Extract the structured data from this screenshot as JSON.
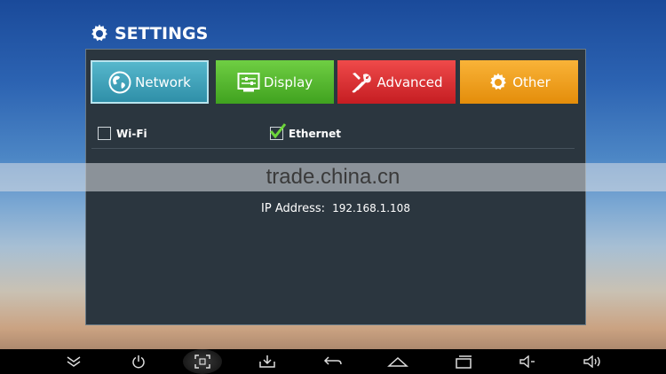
{
  "header": {
    "title": "SETTINGS",
    "icon": "gear-icon"
  },
  "tabs": [
    {
      "label": "Network",
      "icon": "globe-icon",
      "color": "#3aa0b9",
      "selected": true
    },
    {
      "label": "Display",
      "icon": "display-icon",
      "color": "#4fb82c"
    },
    {
      "label": "Advanced",
      "icon": "tools-icon",
      "color": "#d92c2f"
    },
    {
      "label": "Other",
      "icon": "gear-icon",
      "color": "#f0a020"
    }
  ],
  "options": [
    {
      "label": "Wi-Fi",
      "checked": false
    },
    {
      "label": "Ethernet",
      "checked": true
    }
  ],
  "network": {
    "ip_label": "IP Address:",
    "ip_value": "192.168.1.108"
  },
  "watermark": "trade.china.cn",
  "navbar": [
    {
      "icon": "collapse-chevron-icon"
    },
    {
      "icon": "power-icon"
    },
    {
      "icon": "screenshot-icon"
    },
    {
      "icon": "download-icon"
    },
    {
      "icon": "back-icon"
    },
    {
      "icon": "home-icon"
    },
    {
      "icon": "recent-apps-icon"
    },
    {
      "icon": "volume-down-icon"
    },
    {
      "icon": "volume-up-icon"
    }
  ]
}
